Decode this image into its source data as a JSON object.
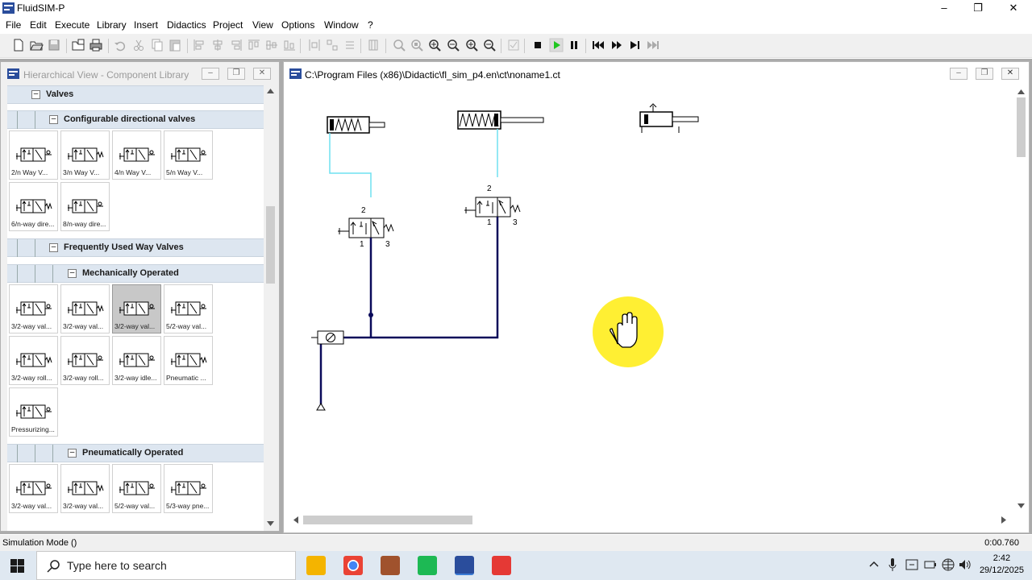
{
  "app": {
    "title": "FluidSIM-P"
  },
  "window_controls": {
    "minimize": "–",
    "restore": "❐",
    "close": "✕"
  },
  "menu": [
    "File",
    "Edit",
    "Execute",
    "Library",
    "Insert",
    "Didactics",
    "Project",
    "View",
    "Options",
    "Window",
    "?"
  ],
  "toolbar": {
    "icons": [
      "new-icon",
      "open-icon",
      "save-icon",
      "open-project-icon",
      "print-icon",
      "undo-icon",
      "cut-icon",
      "copy-icon",
      "paste-icon",
      "align-left-icon",
      "align-center-icon",
      "align-right-icon",
      "align-top-icon",
      "align-middle-icon",
      "align-bottom-icon",
      "grid-icon",
      "zoom-component-icon",
      "zoom-window-icon",
      "zoom-fit-icon",
      "zoom-previous-icon",
      "zoom-in-icon",
      "zoom-out-icon",
      "check-icon",
      "stop-icon",
      "play-icon",
      "pause-icon",
      "reset-icon",
      "step-icon",
      "step-to-end-icon",
      "simulate-to-end-icon"
    ]
  },
  "library_panel": {
    "title": "Hierarchical View - Component Library",
    "groups": {
      "valves": "Valves",
      "configurable": "Configurable directional valves",
      "frequent": "Frequently Used Way Valves",
      "mechanical": "Mechanically Operated",
      "pneumatic": "Pneumatically Operated"
    },
    "configurable_items": [
      "2/n Way V...",
      "3/n Way V...",
      "4/n Way V...",
      "5/n Way V...",
      "6/n-way dire...",
      "8/n-way dire..."
    ],
    "mechanical_items": [
      "3/2-way val...",
      "3/2-way val...",
      "3/2-way val...",
      "5/2-way val...",
      "3/2-way roll...",
      "3/2-way roll...",
      "3/2-way idle...",
      "Pneumatic ...",
      "Pressurizing..."
    ],
    "pneumatic_items": [
      "3/2-way val...",
      "3/2-way val...",
      "5/2-way val...",
      "5/3-way pne..."
    ]
  },
  "circuit_window": {
    "title": "C:\\Program Files (x86)\\Didactic\\fl_sim_p4.en\\ct\\noname1.ct",
    "port_labels": {
      "valve1": [
        "2",
        "1",
        "3"
      ],
      "valve2": [
        "2",
        "1",
        "3"
      ]
    }
  },
  "status": {
    "left": "Simulation Mode ()",
    "right": "0:00.760"
  },
  "taskbar": {
    "search_placeholder": "Type here to search",
    "time": "2:42",
    "date": "29/12/2025"
  }
}
